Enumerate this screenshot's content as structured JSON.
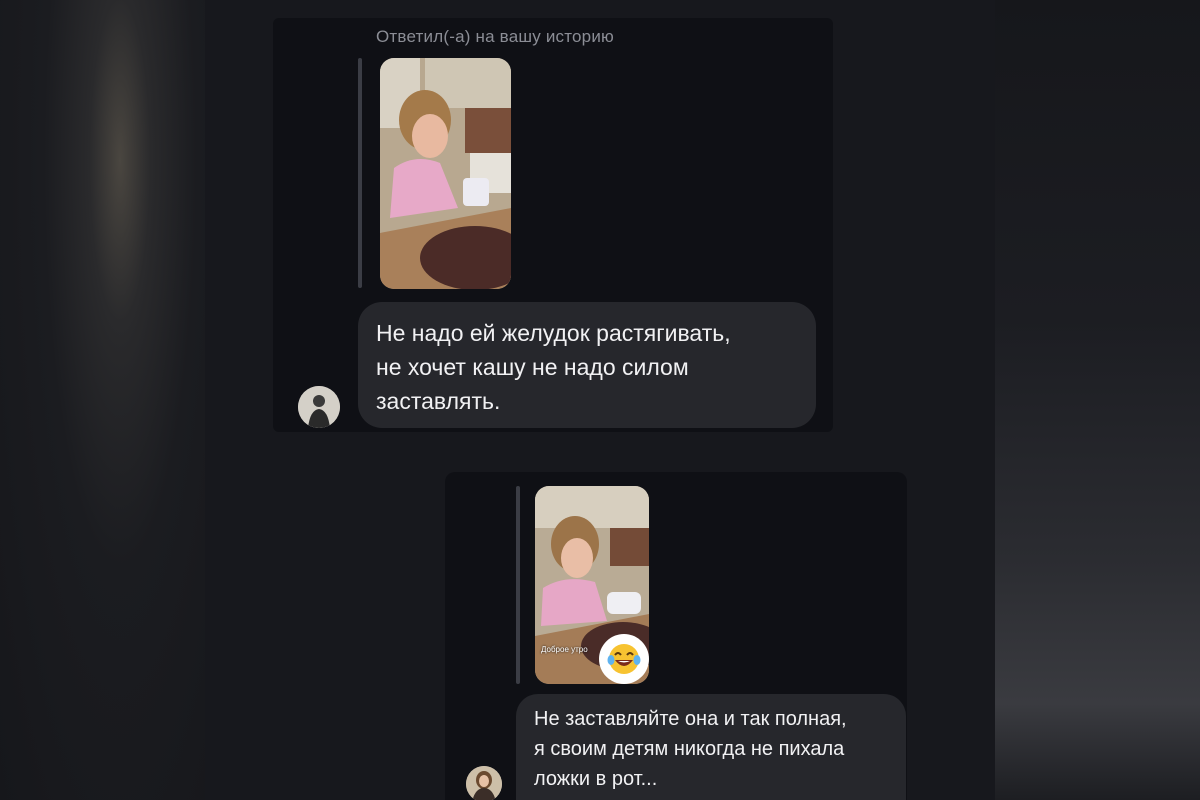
{
  "conversation": {
    "reply_caption": "Ответил(-а) на вашу историю",
    "messages": [
      {
        "text_lines": [
          "Не надо ей желудок растягивать,",
          "не хочет кашу не надо силом",
          "заставлять."
        ]
      },
      {
        "story_caption": "Доброе утро",
        "story_reaction_icon": "laughing-crying-emoji-icon",
        "text_lines": [
          "Не заставляйте она и так полная,",
          "я своим детям никогда не пихала",
          "ложки в рот..."
        ]
      }
    ]
  },
  "colors": {
    "background": "#15161b",
    "panel": "#0f1015",
    "bubble": "#26272c",
    "caption": "#8b8d95",
    "text": "#f1f1f3"
  }
}
